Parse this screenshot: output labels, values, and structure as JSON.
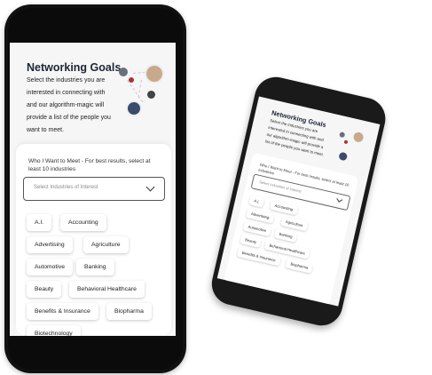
{
  "screen": {
    "title": "Networking Goals",
    "description": "Select the industries you are interested in connecting with and our algorithm-magic will provide a list of the people you want to meet.",
    "select_label": "Who I Want to Meet - For best results, select at least 10 industries",
    "select_placeholder": "Select Industries of Interest",
    "chips": [
      "A.I.",
      "Accounting",
      "Advertising",
      "Agriculture",
      "Automotive",
      "Banking",
      "Beauty",
      "Behavioral Healthcare",
      "Benefits & Insurance",
      "Biopharma",
      "Biotechnology"
    ]
  },
  "colors": {
    "title": "#1d2436",
    "phone_frame": "#111111",
    "screen_bg": "#f6f6f6",
    "card_bg": "#ffffff"
  },
  "icons": [
    "chevron-down-icon",
    "avatar-icon"
  ]
}
